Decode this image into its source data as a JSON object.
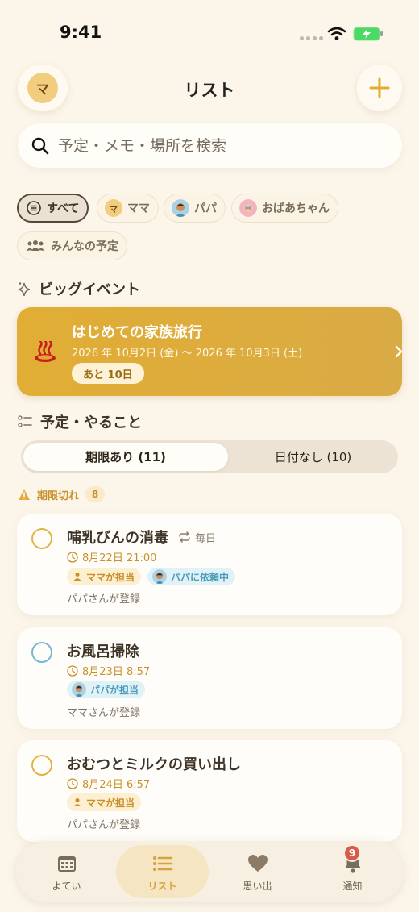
{
  "status_bar": {
    "time": "9:41"
  },
  "header": {
    "title": "リスト",
    "avatar_initial": "マ"
  },
  "search": {
    "placeholder": "予定・メモ・場所を検索",
    "value": ""
  },
  "filters": [
    {
      "label": "すべて",
      "icon": "list-circle-icon",
      "active": true
    },
    {
      "label": "ママ",
      "icon": "mama-avatar"
    },
    {
      "label": "パパ",
      "icon": "papa-avatar"
    },
    {
      "label": "おばあちゃん",
      "icon": "grandma-avatar"
    },
    {
      "label": "みんなの予定",
      "icon": "people-icon"
    }
  ],
  "filter_mama_initial": "マ",
  "big_event_section": {
    "title": "ビッグイベント"
  },
  "big_event": {
    "emoji": "hot-springs-icon",
    "title": "はじめての家族旅行",
    "dates": "2026 年 10月2日 (金) 〜 2026 年 10月3日 (土)",
    "countdown": "あと 10日"
  },
  "todo_section": {
    "title": "予定・やること"
  },
  "segments": [
    {
      "label": "期限あり (11)",
      "active": true
    },
    {
      "label": "日付なし (10)",
      "active": false
    }
  ],
  "overdue": {
    "label": "期限切れ",
    "count": "8"
  },
  "tasks": [
    {
      "title": "哺乳びんの消毒",
      "repeat": "毎日",
      "due": "8月22日 21:00",
      "tags": [
        {
          "label": "ママが担当",
          "kind": "mama"
        },
        {
          "label": "パパに依頼中",
          "kind": "papa"
        }
      ],
      "owner": "パパさんが登録"
    },
    {
      "title": "お風呂掃除",
      "due": "8月23日 8:57",
      "tags": [
        {
          "label": "パパが担当",
          "kind": "papa"
        }
      ],
      "owner": "ママさんが登録"
    },
    {
      "title": "おむつとミルクの買い出し",
      "due": "8月24日 6:57",
      "tags": [
        {
          "label": "ママが担当",
          "kind": "mama"
        }
      ],
      "owner": "パパさんが登録"
    }
  ],
  "tabbar": [
    {
      "label": "よてい",
      "icon": "calendar-icon"
    },
    {
      "label": "リスト",
      "icon": "list-icon",
      "active": true
    },
    {
      "label": "思い出",
      "icon": "heart-icon"
    },
    {
      "label": "通知",
      "icon": "bell-icon",
      "badge": "9"
    }
  ],
  "colors": {
    "background": "#fcf6ea",
    "accent": "#e1ad34",
    "mama": "#f2cd80",
    "papa": "#74b8d2",
    "badge": "#d85b4a"
  }
}
